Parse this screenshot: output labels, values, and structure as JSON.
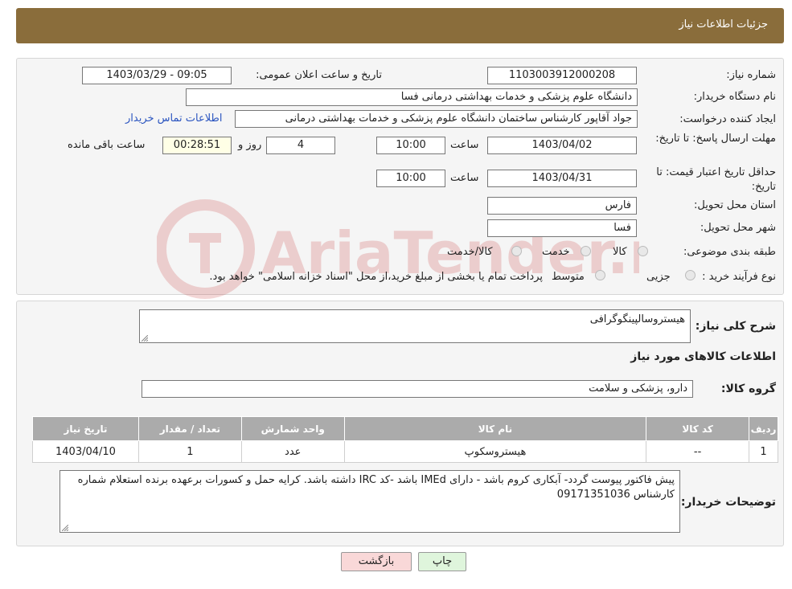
{
  "header": {
    "title": "جزئیات اطلاعات نیاز"
  },
  "form": {
    "need_number_label": "شماره نیاز:",
    "need_number": "1103003912000208",
    "announce_label": "تاریخ و ساعت اعلان عمومی:",
    "announce_value": "1403/03/29 - 09:05",
    "buyer_org_label": "نام دستگاه خریدار:",
    "buyer_org": "دانشگاه علوم پزشکی و خدمات بهداشتی درمانی فسا",
    "creator_label": "ایجاد کننده درخواست:",
    "creator": "جواد آقاپور کارشناس ساختمان دانشگاه علوم پزشکی و خدمات بهداشتی درمانی",
    "contact_link": "اطلاعات تماس خریدار",
    "deadline_label": "مهلت ارسال پاسخ: تا تاریخ:",
    "deadline_date": "1403/04/02",
    "hour_label": "ساعت",
    "deadline_time": "10:00",
    "days_value": "4",
    "days_label": "روز و",
    "remaining_time": "00:28:51",
    "remaining_label": "ساعت باقی مانده",
    "validity_label": "حداقل تاریخ اعتبار قیمت: تا تاریخ:",
    "validity_date": "1403/04/31",
    "validity_time": "10:00",
    "province_label": "استان محل تحویل:",
    "province": "فارس",
    "city_label": "شهر محل تحویل:",
    "city": "فسا",
    "category_label": "طبقه بندی موضوعی:",
    "category_options": [
      "کالا",
      "خدمت",
      "کالا/خدمت"
    ],
    "process_label": "نوع فرآیند خرید :",
    "process_options": [
      "جزیی",
      "متوسط"
    ],
    "process_note": "پرداخت تمام یا بخشی از مبلغ خرید،از محل \"اسناد خزانه اسلامی\" خواهد بود."
  },
  "watermark": {
    "text": "AriaTender.neT"
  },
  "details": {
    "summary_label": "شرح کلی نیاز:",
    "summary": "هیستروسالپینگوگرافی",
    "goods_info_title": "اطلاعات کالاهای مورد نیاز",
    "goods_group_label": "گروه کالا:",
    "goods_group": "دارو، پزشکی و سلامت"
  },
  "table": {
    "headers": [
      "ردیف",
      "کد کالا",
      "نام کالا",
      "واحد شمارش",
      "تعداد / مقدار",
      "تاریخ نیاز"
    ],
    "rows": [
      [
        "1",
        "--",
        "هیستروسکوپ",
        "عدد",
        "1",
        "1403/04/10"
      ]
    ]
  },
  "buyer_notes": {
    "label": "توضیحات خریدار:",
    "text": "پیش فاکتور پیوست گردد- آبکاری کروم باشد - دارای IMEd باشد -کد IRC داشته باشد. کرایه حمل و کسورات برعهده برنده استعلام  شماره کارشناس 09171351036"
  },
  "buttons": {
    "back": "بازگشت",
    "print": "چاپ"
  },
  "colors": {
    "header_bg": "#8a6d3b",
    "link": "#2b55c0",
    "table_header": "#ababab"
  }
}
